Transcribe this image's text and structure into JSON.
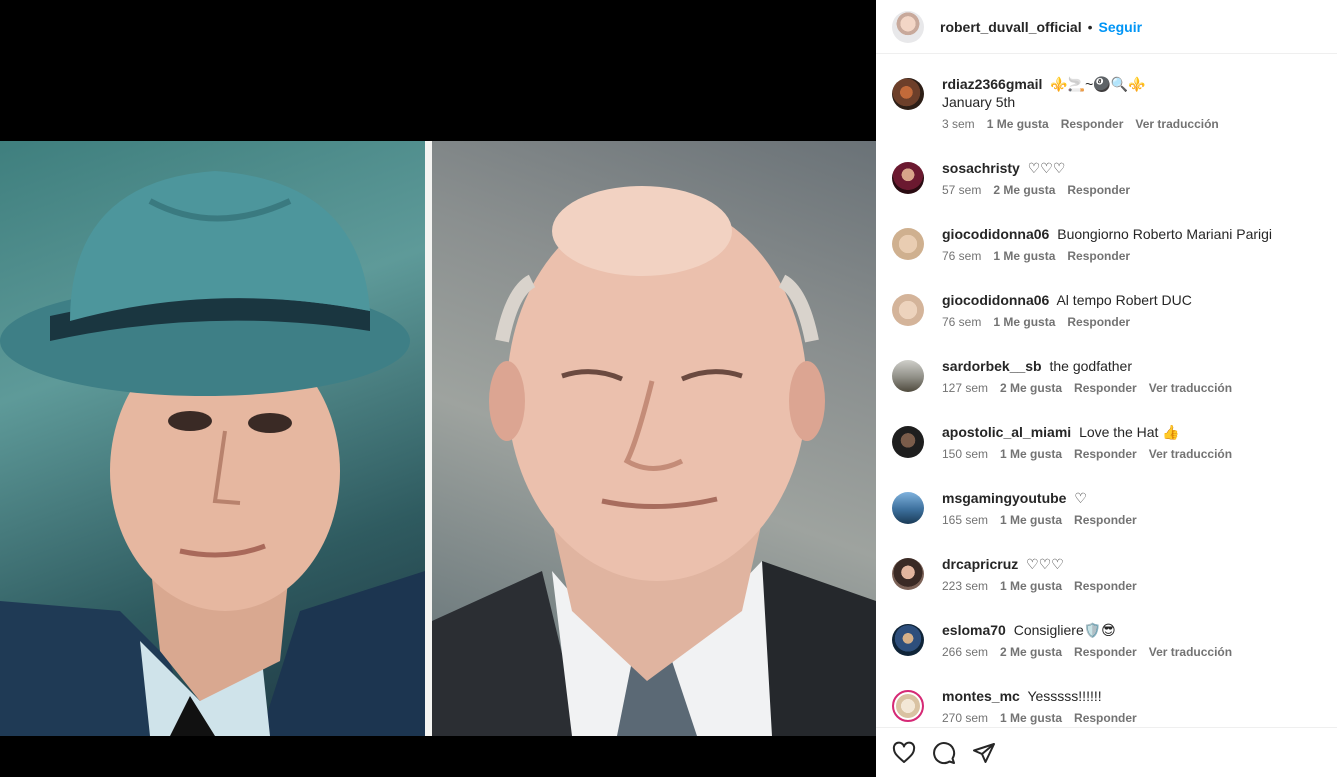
{
  "post": {
    "owner": "robert_duvall_official",
    "separator": "•",
    "follow_label": "Seguir"
  },
  "comments": [
    {
      "user": "rdiaz2366gmail",
      "text": "⚜️🚬~🎱🔍⚜️",
      "text_line2": "January 5th",
      "age": "3 sem",
      "likes": "1 Me gusta",
      "reply": "Responder",
      "translate": "Ver traducción"
    },
    {
      "user": "sosachristy",
      "text": "♡♡♡",
      "age": "57 sem",
      "likes": "2 Me gusta",
      "reply": "Responder"
    },
    {
      "user": "giocodidonna06",
      "text": "Buongiorno Roberto Mariani Parigi",
      "age": "76 sem",
      "likes": "1 Me gusta",
      "reply": "Responder"
    },
    {
      "user": "giocodidonna06",
      "text": "Al tempo Robert DUC",
      "age": "76 sem",
      "likes": "1 Me gusta",
      "reply": "Responder"
    },
    {
      "user": "sardorbek__sb",
      "text": "the godfather",
      "age": "127 sem",
      "likes": "2 Me gusta",
      "reply": "Responder",
      "translate": "Ver traducción"
    },
    {
      "user": "apostolic_al_miami",
      "text": "Love the Hat 👍",
      "age": "150 sem",
      "likes": "1 Me gusta",
      "reply": "Responder",
      "translate": "Ver traducción"
    },
    {
      "user": "msgamingyoutube",
      "text": "♡",
      "age": "165 sem",
      "likes": "1 Me gusta",
      "reply": "Responder"
    },
    {
      "user": "drcapricruz",
      "text": "♡♡♡",
      "age": "223 sem",
      "likes": "1 Me gusta",
      "reply": "Responder"
    },
    {
      "user": "esloma70",
      "text": "Consigliere🛡️😎",
      "age": "266 sem",
      "likes": "2 Me gusta",
      "reply": "Responder",
      "translate": "Ver traducción"
    },
    {
      "user": "montes_mc",
      "text": "Yesssss!!!!!!",
      "age": "270 sem",
      "likes": "1 Me gusta",
      "reply": "Responder"
    }
  ],
  "icons": {
    "like": "heart-outline-icon",
    "comment": "comment-bubble-icon",
    "share": "paper-plane-icon"
  }
}
